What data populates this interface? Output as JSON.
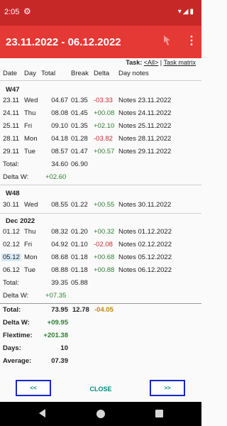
{
  "status_bar": {
    "time": "2:05",
    "icons": "▾◢▮"
  },
  "app_bar": {
    "title": "23.11.2022 - 06.12.2022"
  },
  "task": {
    "label": "Task:",
    "all": "<All>",
    "sep": "|",
    "matrix": "Task matrix"
  },
  "columns": {
    "date": "Date",
    "day": "Day",
    "total": "Total",
    "break": "Break",
    "delta": "Delta",
    "notes": "Day notes"
  },
  "w47": {
    "label": "W47",
    "rows": [
      {
        "date": "23.11",
        "day": "Wed",
        "total": "04.67",
        "break": "01.35",
        "delta": "-03.33",
        "notes": "Notes 23.11.2022"
      },
      {
        "date": "24.11",
        "day": "Thu",
        "total": "08.08",
        "break": "01.45",
        "delta": "+00.08",
        "notes": "Notes 24.11.2022"
      },
      {
        "date": "25.11",
        "day": "Fri",
        "total": "09.10",
        "break": "01.35",
        "delta": "+02.10",
        "notes": "Notes 25.11.2022"
      },
      {
        "date": "28.11",
        "day": "Mon",
        "total": "04.18",
        "break": "01.28",
        "delta": "-03.82",
        "notes": "Notes 28.11.2022"
      },
      {
        "date": "29.11",
        "day": "Tue",
        "total": "08.57",
        "break": "01.47",
        "delta": "+00.57",
        "notes": "Notes 29.11.2022"
      }
    ],
    "total_label": "Total:",
    "total": "34.60",
    "total_break": "06.90",
    "deltaw_label": "Delta W:",
    "deltaw": "+02.60"
  },
  "w48": {
    "label": "W48",
    "rows": [
      {
        "date": "30.11",
        "day": "Wed",
        "total": "08.55",
        "break": "01.22",
        "delta": "+00.55",
        "notes": "Notes 30.11.2022"
      }
    ]
  },
  "dec": {
    "label": "Dec 2022",
    "rows": [
      {
        "date": "01.12",
        "day": "Thu",
        "total": "08.32",
        "break": "01.20",
        "delta": "+00.32",
        "notes": "Notes 01.12.2022"
      },
      {
        "date": "02.12",
        "day": "Fri",
        "total": "04.92",
        "break": "01.10",
        "delta": "-02.08",
        "notes": "Notes 02.12.2022"
      },
      {
        "date": "05.12",
        "day": "Mon",
        "total": "08.68",
        "break": "01.18",
        "delta": "+00.68",
        "notes": "Notes 05.12.2022"
      },
      {
        "date": "06.12",
        "day": "Tue",
        "total": "08.88",
        "break": "01.18",
        "delta": "+00.88",
        "notes": "Notes 06.12.2022"
      }
    ],
    "total_label": "Total:",
    "total": "39.35",
    "total_break": "05.88",
    "deltaw_label": "Delta W:",
    "deltaw": "+07.35"
  },
  "summary": {
    "total_label": "Total:",
    "total": "73.95",
    "total_break": "12.78",
    "total_delta": "-04.05",
    "deltaw_label": "Delta W:",
    "deltaw": "+09.95",
    "flextime_label": "Flextime:",
    "flextime": "+201.38",
    "days_label": "Days:",
    "days": "10",
    "average_label": "Average:",
    "average": "07.39"
  },
  "footer": {
    "prev": "<<",
    "close": "CLOSE",
    "next": ">>"
  },
  "colors": {
    "status_bar": "#c62828",
    "app_bar": "#e53935",
    "positive": "#2e7d32",
    "negative": "#c62828",
    "teal": "#00897b",
    "button_border": "#1428c8"
  }
}
